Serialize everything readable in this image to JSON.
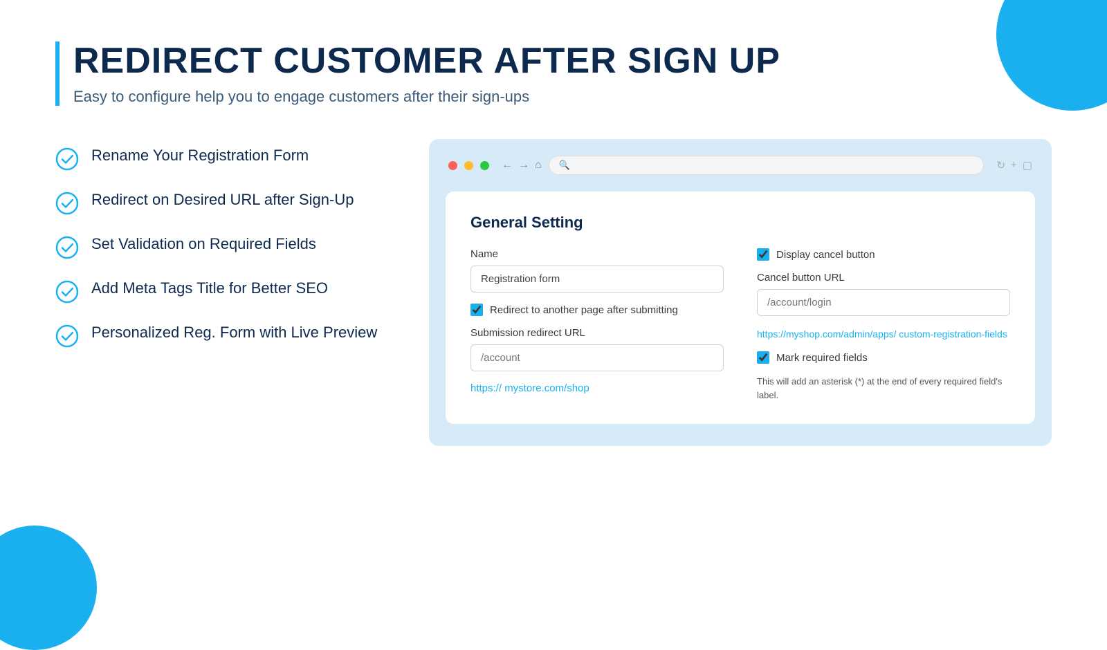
{
  "page": {
    "heading": "REDIRECT CUSTOMER AFTER SIGN UP",
    "subtitle": "Easy to configure help you to engage customers after their sign-ups"
  },
  "features": [
    {
      "id": 1,
      "text": "Rename Your Registration Form"
    },
    {
      "id": 2,
      "text": "Redirect on Desired URL after Sign-Up"
    },
    {
      "id": 3,
      "text": "Set Validation on Required Fields"
    },
    {
      "id": 4,
      "text": "Add Meta Tags Title for Better SEO"
    },
    {
      "id": 5,
      "text": "Personalized Reg. Form with Live Preview"
    }
  ],
  "browser": {
    "search_placeholder": "Search"
  },
  "settings": {
    "title": "General Setting",
    "name_label": "Name",
    "name_value": "Registration form",
    "redirect_checkbox_label": "Redirect to another page after  submitting",
    "redirect_checked": true,
    "submission_redirect_label": "Submission redirect URL",
    "submission_redirect_placeholder": "/account",
    "submission_link": "https:// mystore.com/shop",
    "display_cancel_label": "Display cancel button",
    "display_cancel_checked": true,
    "cancel_url_label": "Cancel button URL",
    "cancel_url_placeholder": "/account/login",
    "app_link": "https://myshop.com/admin/apps/\ncustom-registration-fields",
    "mark_required_label": "Mark required fields",
    "mark_required_checked": true,
    "required_helper": "This will add an asterisk (*) at the end of every required field's label."
  }
}
